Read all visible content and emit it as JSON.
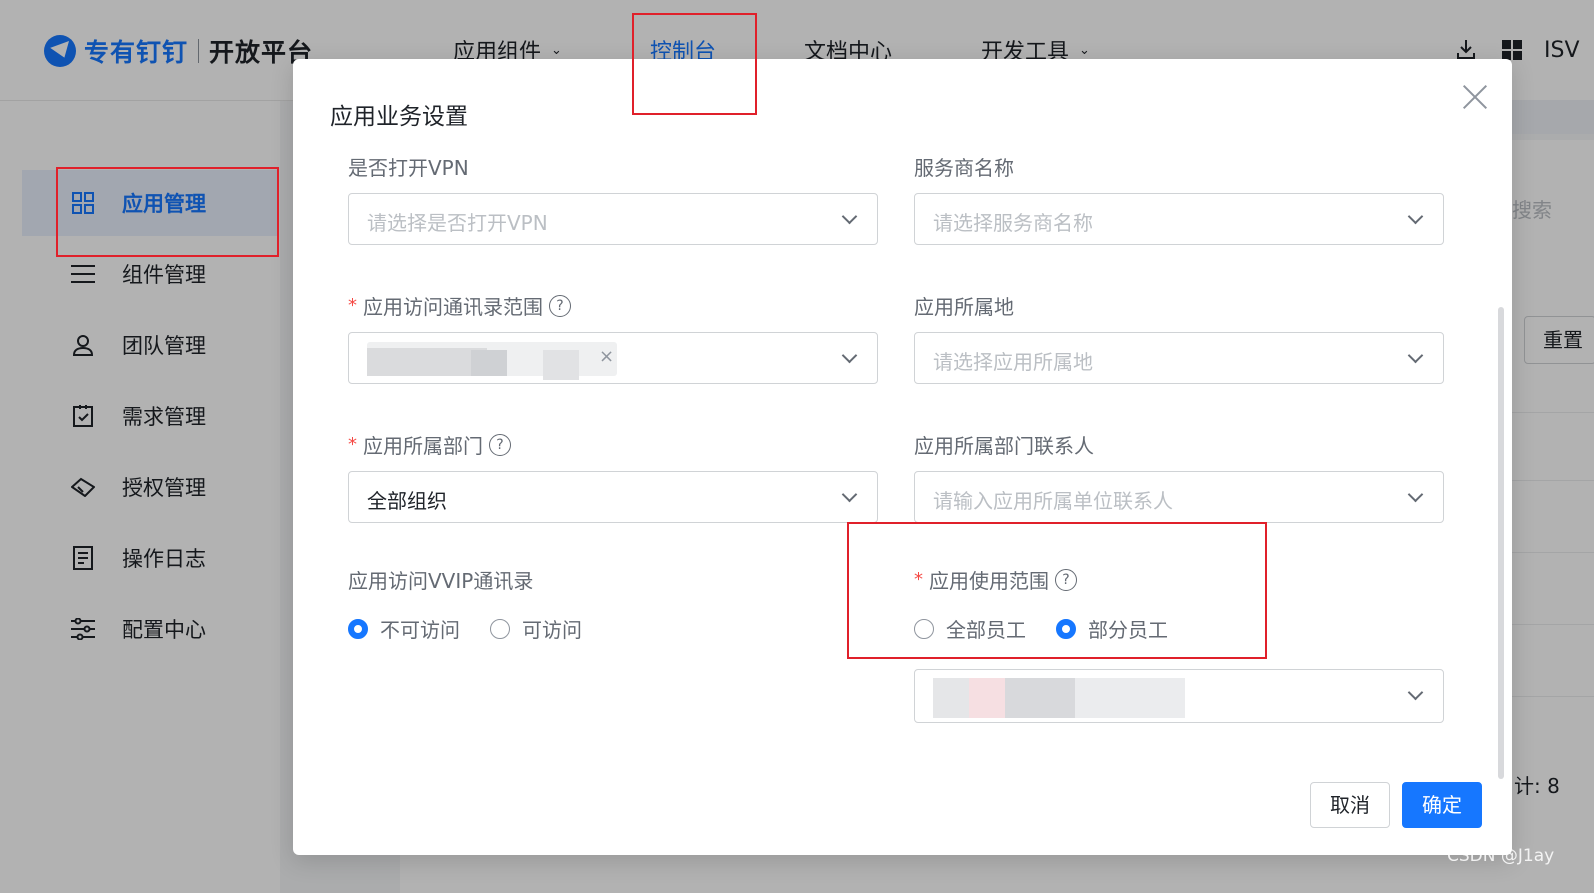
{
  "topbar": {
    "brand": "专有钉钉",
    "subtitle": "开放平台",
    "nav": [
      {
        "label": "应用组件",
        "has_dropdown": true
      },
      {
        "label": "控制台",
        "active": true
      },
      {
        "label": "文档中心"
      },
      {
        "label": "开发工具",
        "has_dropdown": true
      }
    ],
    "right": {
      "download_icon": "download-icon",
      "apps_icon": "grid-icon",
      "label": "ISV"
    }
  },
  "sidebar": {
    "items": [
      {
        "label": "应用管理",
        "icon": "apps-grid-icon",
        "active": true
      },
      {
        "label": "组件管理",
        "icon": "menu-icon"
      },
      {
        "label": "团队管理",
        "icon": "team-icon"
      },
      {
        "label": "需求管理",
        "icon": "clipboard-check-icon"
      },
      {
        "label": "授权管理",
        "icon": "handshake-icon"
      },
      {
        "label": "操作日志",
        "icon": "log-icon"
      },
      {
        "label": "配置中心",
        "icon": "sliders-icon"
      }
    ]
  },
  "background": {
    "search_text": "搜索",
    "reset_text": "重置",
    "count_text": "计: 8"
  },
  "modal": {
    "title": "应用业务设置",
    "fields": {
      "vpn": {
        "label": "是否打开VPN",
        "placeholder": "请选择是否打开VPN"
      },
      "provider": {
        "label": "服务商名称",
        "placeholder": "请选择服务商名称"
      },
      "contacts_scope": {
        "label": "应用访问通讯录范围",
        "required": true,
        "has_help": true
      },
      "location": {
        "label": "应用所属地",
        "placeholder": "请选择应用所属地"
      },
      "department": {
        "label": "应用所属部门",
        "required": true,
        "has_help": true,
        "value": "全部组织"
      },
      "dept_contact": {
        "label": "应用所属部门联系人",
        "placeholder": "请输入应用所属单位联系人"
      },
      "vvip": {
        "label": "应用访问VVIP通讯录",
        "options": [
          {
            "label": "不可访问",
            "checked": true
          },
          {
            "label": "可访问",
            "checked": false
          }
        ]
      },
      "usage_scope": {
        "label": "应用使用范围",
        "required": true,
        "has_help": true,
        "options": [
          {
            "label": "全部员工",
            "checked": false
          },
          {
            "label": "部分员工",
            "checked": true
          }
        ]
      }
    },
    "buttons": {
      "cancel": "取消",
      "ok": "确定"
    }
  },
  "watermark": "CSDN @J1ay",
  "colors": {
    "accent": "#1677ff",
    "annotation_red": "#e0202a",
    "required": "#f54a45"
  }
}
